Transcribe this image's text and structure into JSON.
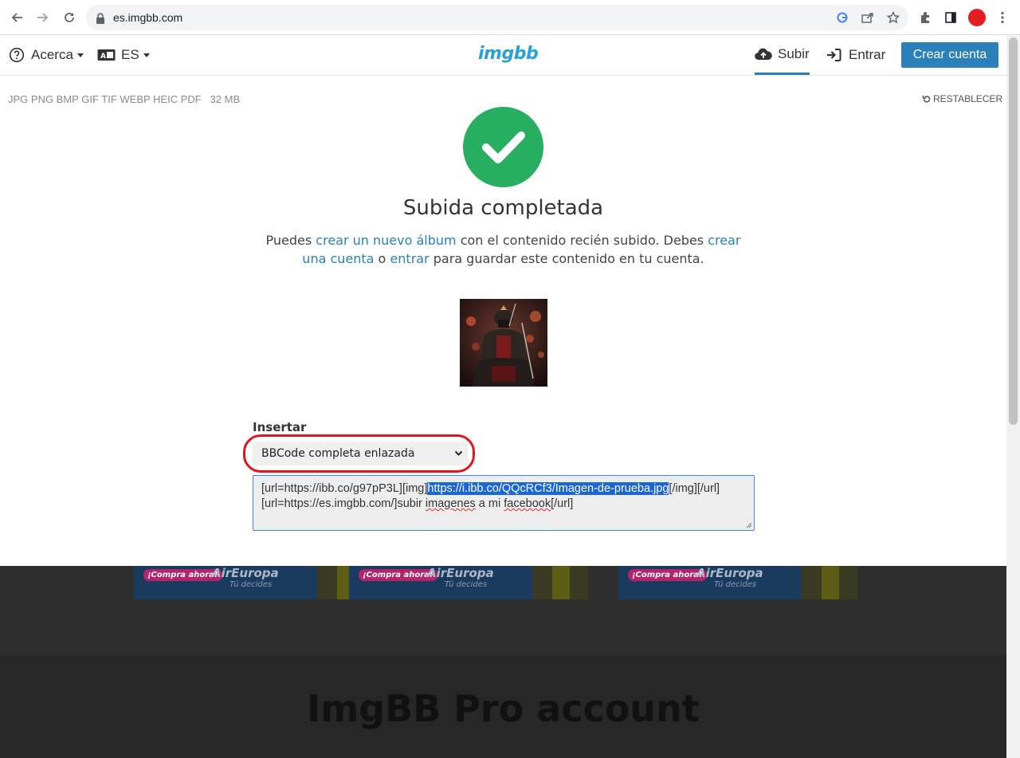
{
  "browser": {
    "url": "es.imgbb.com"
  },
  "header": {
    "about_label": "Acerca",
    "language_label": "ES",
    "logo_text": "imgbb",
    "upload_label": "Subir",
    "login_label": "Entrar",
    "create_account_label": "Crear cuenta"
  },
  "upload": {
    "formats": "JPG PNG BMP GIF TIF WEBP HEIC PDF",
    "max_size": "32 MB",
    "reset_label": "RESTABLECER",
    "title": "Subida completada",
    "desc_1": "Puedes ",
    "desc_link_1": "crear un nuevo álbum",
    "desc_2": " con el contenido recién subido. Debes ",
    "desc_link_2": "crear una cuenta",
    "desc_3": " o ",
    "desc_link_3": "entrar",
    "desc_4": " para guardar este contenido en tu cuenta."
  },
  "embed": {
    "label": "Insertar",
    "selected_option": "BBCode completa enlazada",
    "code_pre": "[url=https://ibb.co/g97pP3L][img]",
    "code_selected": "https://i.ibb.co/QQcRCf3/Imagen-de-prueba.jpg",
    "code_post": "[/img][/url]",
    "code_line2_a": "[url=https://es.imgbb.com/]subir ",
    "code_line2_b": "imagenes",
    "code_line2_c": " a mi ",
    "code_line2_d": "facebook",
    "code_line2_e": "[/url]"
  },
  "ads": [
    {
      "buy_label": "¡Compra ahora!",
      "brand": "AirEuropa",
      "tagline": "Tú decides"
    },
    {
      "buy_label": "¡Compra ahora!",
      "brand": "AirEuropa",
      "tagline": "Tú decides"
    },
    {
      "buy_label": "¡Compra ahora!",
      "brand": "AirEuropa",
      "tagline": "Tú decides"
    }
  ],
  "promo": {
    "title": "ImgBB Pro account"
  },
  "colors": {
    "accent": "#2a80b9",
    "success": "#27ae60",
    "highlight_ring": "#e3141b"
  }
}
